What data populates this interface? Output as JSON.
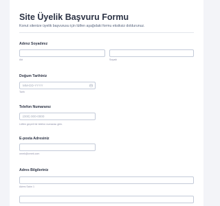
{
  "form": {
    "title": "Site Üyelik Başvuru Formu",
    "subtitle": "Konut sitenize üyelik başvurusu için lütfen aşağıdaki formu eksiksiz doldurunuz."
  },
  "name": {
    "label": "Adınız Soyadınız",
    "first_sub": "Adı",
    "last_sub": "Soyadı"
  },
  "dob": {
    "label": "Doğum Tarihiniz",
    "placeholder": "MM-DD-YYYY",
    "sub": "Tarih",
    "icon": "calendar-icon"
  },
  "phone": {
    "label": "Telefon Numaranız",
    "placeholder": "(000) 000-0000",
    "sub": "Lütfen geçerli bir telefon numarası girin."
  },
  "email": {
    "label": "E-posta Adresiniz",
    "sub": "ornek@ornek.com"
  },
  "address": {
    "label": "Adres Bilgileriniz",
    "line1_sub": "Adres Satırı 1"
  }
}
